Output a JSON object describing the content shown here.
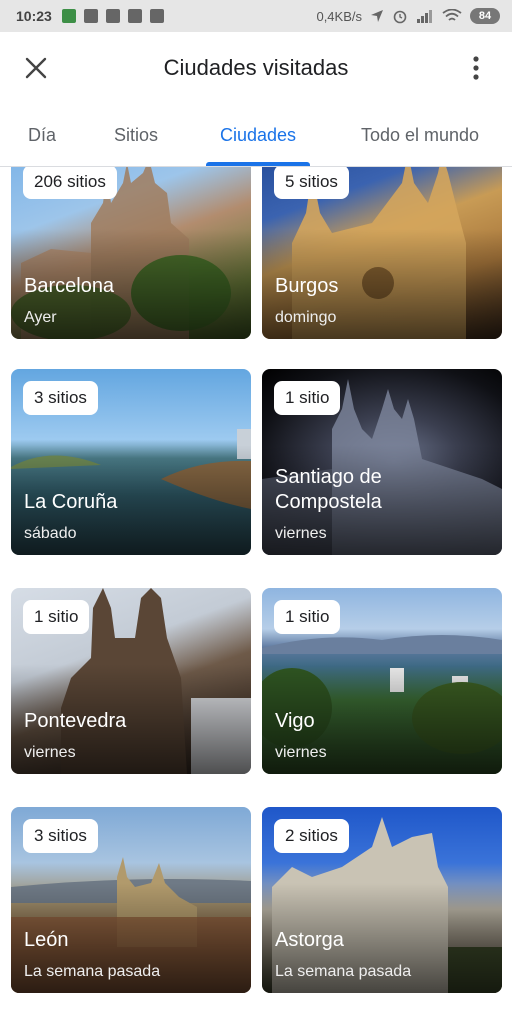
{
  "status_bar": {
    "time": "10:23",
    "network_speed": "0,4KB/s",
    "battery": "84"
  },
  "app_bar": {
    "title": "Ciudades visitadas",
    "close_icon": "close-icon",
    "menu_icon": "more-vert-icon"
  },
  "tabs": [
    {
      "label": "Día",
      "active": false
    },
    {
      "label": "Sitios",
      "active": false
    },
    {
      "label": "Ciudades",
      "active": true
    },
    {
      "label": "Todo el mundo",
      "active": false
    }
  ],
  "accent_color": "#1a73e8",
  "cities": [
    {
      "name": "Barcelona",
      "when": "Ayer",
      "badge": "206 sitios"
    },
    {
      "name": "Burgos",
      "when": "domingo",
      "badge": "5 sitios"
    },
    {
      "name": "La Coruña",
      "when": "sábado",
      "badge": "3 sitios"
    },
    {
      "name": "Santiago de Compostela",
      "when": "viernes",
      "badge": "1 sitio"
    },
    {
      "name": "Pontevedra",
      "when": "viernes",
      "badge": "1 sitio"
    },
    {
      "name": "Vigo",
      "when": "viernes",
      "badge": "1 sitio"
    },
    {
      "name": "León",
      "when": "La semana pasada",
      "badge": "3 sitios"
    },
    {
      "name": "Astorga",
      "when": "La semana pasada",
      "badge": "2 sitios"
    }
  ]
}
